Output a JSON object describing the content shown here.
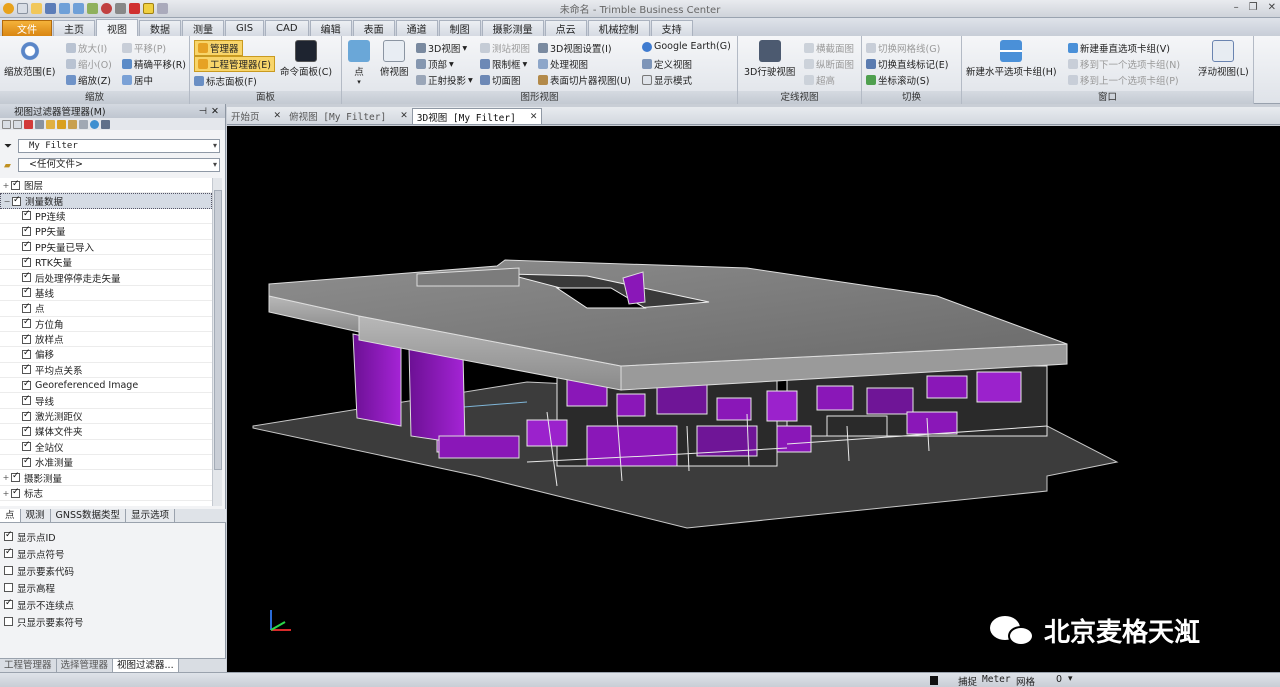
{
  "window": {
    "title": "未命名 - Trimble Business Center"
  },
  "menu": {
    "tabs": [
      "文件",
      "主页",
      "视图",
      "数据",
      "测量",
      "GIS",
      "CAD",
      "编辑",
      "表面",
      "通道",
      "制图",
      "摄影测量",
      "点云",
      "机械控制",
      "支持"
    ],
    "active": "视图"
  },
  "ribbon": {
    "zoom": {
      "label": "缩放",
      "zoom_range": "缩放范围(E)",
      "zoom_in": "放大(I)",
      "zoom_out": "缩小(O)",
      "zoom_z": "缩放(Z)",
      "pan": "平移(P)",
      "precise_pan": "精确平移(R)",
      "center": "居中"
    },
    "panel": {
      "label": "面板",
      "manager": "管理器",
      "project_manager": "工程管理器(E)",
      "label_panel": "标志面板(F)",
      "command_panel": "命令面板(C)"
    },
    "graphic": {
      "label": "图形视图",
      "point": "点",
      "plan_view": "俯视图",
      "view3d": "3D视图",
      "top": "顶部",
      "ortho": "正射投影",
      "station_view": "测站视图",
      "clip_box": "限制框",
      "section_view": "切面图",
      "view3d_settings": "3D视图设置(I)",
      "process_view": "处理视图",
      "surface_slice": "表面切片器视图(U)",
      "google_earth": "Google Earth(G)",
      "define_view": "定义视图",
      "display_mode": "显示模式"
    },
    "alignment": {
      "label": "定线视图",
      "drive_3d": "3D行驶视图",
      "cross_section": "横截面图",
      "profile": "纵断面图",
      "plan_layout": "超高"
    },
    "switch": {
      "label": "切换",
      "grid_toggle": "切换网格线(G)",
      "line_marks": "切换直线标记(E)",
      "coord_scroll": "坐标滚动(S)"
    },
    "window": {
      "label": "窗口",
      "new_horizontal": "新建水平选项卡组(H)",
      "new_vertical": "新建垂直选项卡组(V)",
      "move_next": "移到下一个选项卡组(N)",
      "move_prev": "移到上一个选项卡组(P)",
      "float_view": "浮动视图(L)"
    }
  },
  "left_panel": {
    "title": "视图过滤器管理器(M)",
    "filter_value": "My Filter",
    "file_value": "<任何文件>",
    "tree": [
      {
        "label": "图层",
        "level": 0,
        "checked": true,
        "expand": "+"
      },
      {
        "label": "测量数据",
        "level": 0,
        "checked": true,
        "expand": "−",
        "selected": true
      },
      {
        "label": "PP连续",
        "level": 1,
        "checked": true
      },
      {
        "label": "PP矢量",
        "level": 1,
        "checked": true
      },
      {
        "label": "PP矢量已导入",
        "level": 1,
        "checked": true
      },
      {
        "label": "RTK矢量",
        "level": 1,
        "checked": true
      },
      {
        "label": "后处理停停走走矢量",
        "level": 1,
        "checked": true
      },
      {
        "label": "基线",
        "level": 1,
        "checked": true
      },
      {
        "label": "点",
        "level": 1,
        "checked": true
      },
      {
        "label": "方位角",
        "level": 1,
        "checked": true
      },
      {
        "label": "放样点",
        "level": 1,
        "checked": true
      },
      {
        "label": "偏移",
        "level": 1,
        "checked": true
      },
      {
        "label": "平均点关系",
        "level": 1,
        "checked": true
      },
      {
        "label": "Georeferenced Image",
        "level": 1,
        "checked": true
      },
      {
        "label": "导线",
        "level": 1,
        "checked": true
      },
      {
        "label": "激光测距仪",
        "level": 1,
        "checked": true
      },
      {
        "label": "媒体文件夹",
        "level": 1,
        "checked": true
      },
      {
        "label": "全站仪",
        "level": 1,
        "checked": true
      },
      {
        "label": "水准测量",
        "level": 1,
        "checked": true
      },
      {
        "label": "摄影测量",
        "level": 0,
        "checked": true,
        "expand": "+"
      },
      {
        "label": "标志",
        "level": 0,
        "checked": true,
        "expand": "+"
      }
    ],
    "sub_tabs": [
      "点",
      "观测",
      "GNSS数据类型",
      "显示选项"
    ],
    "options": [
      {
        "label": "显示点ID",
        "checked": true
      },
      {
        "label": "显示点符号",
        "checked": true
      },
      {
        "label": "显示要素代码",
        "checked": false
      },
      {
        "label": "显示高程",
        "checked": false
      },
      {
        "label": "显示不连续点",
        "checked": true
      },
      {
        "label": "只显示要素符号",
        "checked": false
      }
    ],
    "bottom_tabs": [
      "工程管理器",
      "选择管理器",
      "视图过滤器..."
    ]
  },
  "doc_tabs": [
    {
      "label": "开始页",
      "active": false
    },
    {
      "label": "俯视图 [My Filter]",
      "active": false
    },
    {
      "label": "3D视图 [My Filter]",
      "active": true
    }
  ],
  "status": {
    "snap": "捕捉",
    "unit": "Meter",
    "grid": "网格",
    "value": "0"
  },
  "watermark": "北京麦格天渱",
  "colors": {
    "accent": "#8a17b8",
    "viewport_bg": "#000000",
    "file_tab": "#e8961f"
  }
}
